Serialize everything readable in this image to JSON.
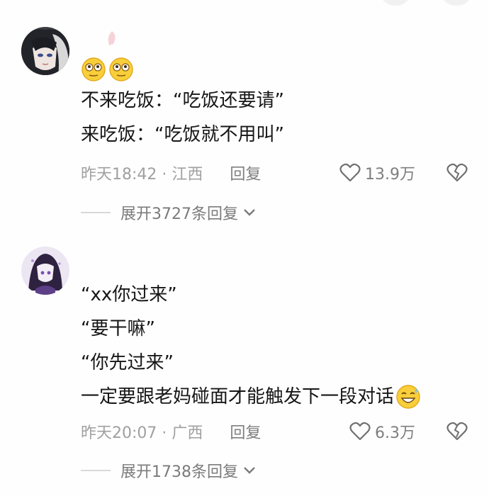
{
  "comments": [
    {
      "lines": [
        "不来吃饭：“吃饭还要请”",
        "来吃饭：“吃饭就不用叫”"
      ],
      "time": "昨天18:42 · 江西",
      "reply_label": "回复",
      "likes": "13.9万",
      "expand_label": "展开3727条回复",
      "icons": {
        "avatar": "anime-avatar",
        "emoji": "smirk-emoji",
        "like": "heart-icon",
        "dislike": "broken-heart-icon",
        "expand": "chevron-down-icon"
      }
    },
    {
      "lines": [
        "“xx你过来”",
        "“要干嘛”",
        "“你先过来”",
        "一定要跟老妈碰面才能触发下一段对话"
      ],
      "time": "昨天20:07 · 广西",
      "reply_label": "回复",
      "likes": "6.3万",
      "expand_label": "展开1738条回复",
      "icons": {
        "avatar": "anime-avatar",
        "emoji": "grin-sweat-emoji",
        "like": "heart-icon",
        "dislike": "broken-heart-icon",
        "expand": "chevron-down-icon"
      }
    }
  ],
  "colors": {
    "text": "#161616",
    "meta": "#a0a0a0",
    "emoji": "#f7c832"
  }
}
